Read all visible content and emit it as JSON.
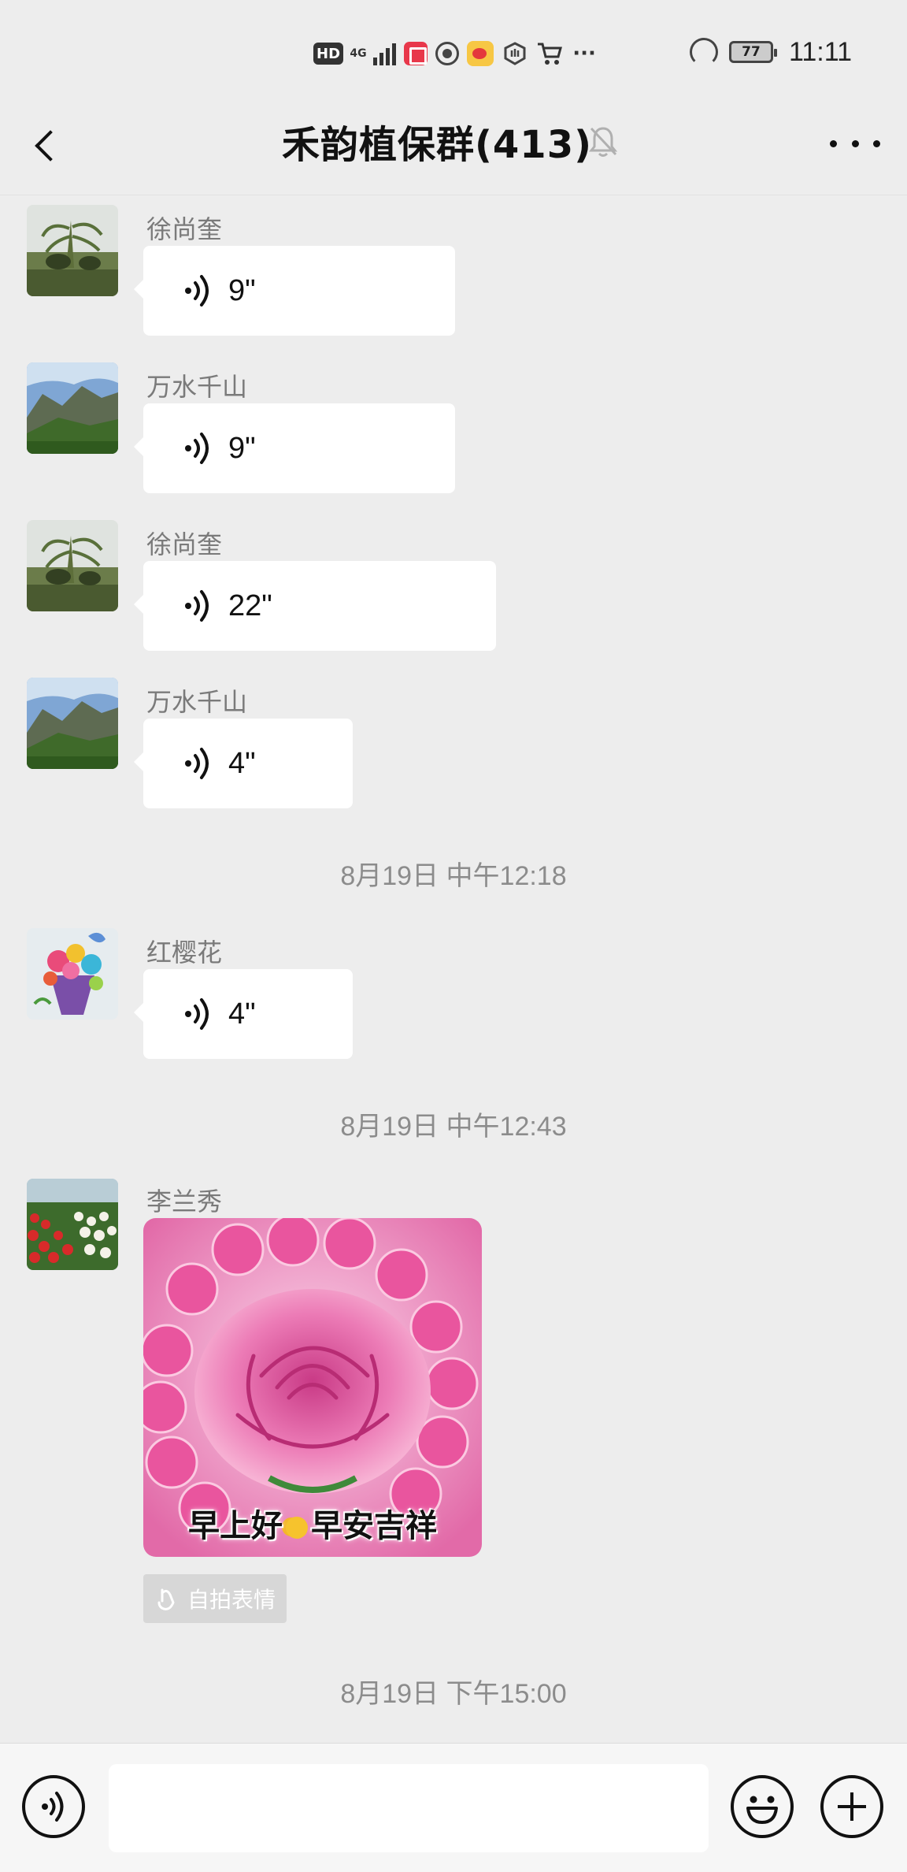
{
  "status_bar": {
    "hd": "HD",
    "network": "4G",
    "battery": "77",
    "time": "11:11",
    "icons": [
      "hd-icon",
      "4g-signal-icon",
      "notes-app-icon",
      "aperture-app-icon",
      "weibo-icon",
      "hand-app-icon",
      "cart-icon",
      "more-notifications-icon",
      "speed-icon",
      "battery-icon"
    ],
    "more": "···"
  },
  "header": {
    "title": "禾韵植保群(413)",
    "icons": [
      "back-icon",
      "mute-bell-icon",
      "more-icon"
    ]
  },
  "messages": [
    {
      "sender": "徐尚奎",
      "type": "voice",
      "duration": "9\""
    },
    {
      "sender": "万水千山",
      "type": "voice",
      "duration": "9\""
    },
    {
      "sender": "徐尚奎",
      "type": "voice",
      "duration": "22\""
    },
    {
      "sender": "万水千山",
      "type": "voice",
      "duration": "4\""
    },
    {
      "sender": "红樱花",
      "type": "voice",
      "duration": "4\""
    },
    {
      "sender": "李兰秀",
      "type": "sticker",
      "caption_left": "早上好",
      "caption_right": "早安吉祥"
    }
  ],
  "timestamps": [
    "8月19日 中午12:18",
    "8月19日 中午12:43",
    "8月19日 下午15:00"
  ],
  "selfie_tag": {
    "label": "自拍表情"
  },
  "input_bar": {
    "placeholder": "",
    "icons": [
      "voice-toggle-icon",
      "emoji-icon",
      "plus-icon"
    ]
  },
  "colors": {
    "background": "#ededed",
    "bubble": "#ffffff",
    "timestamp_text": "#8c8c8c",
    "sender_text": "#7a7a7a",
    "rose": "#e86aa8"
  }
}
